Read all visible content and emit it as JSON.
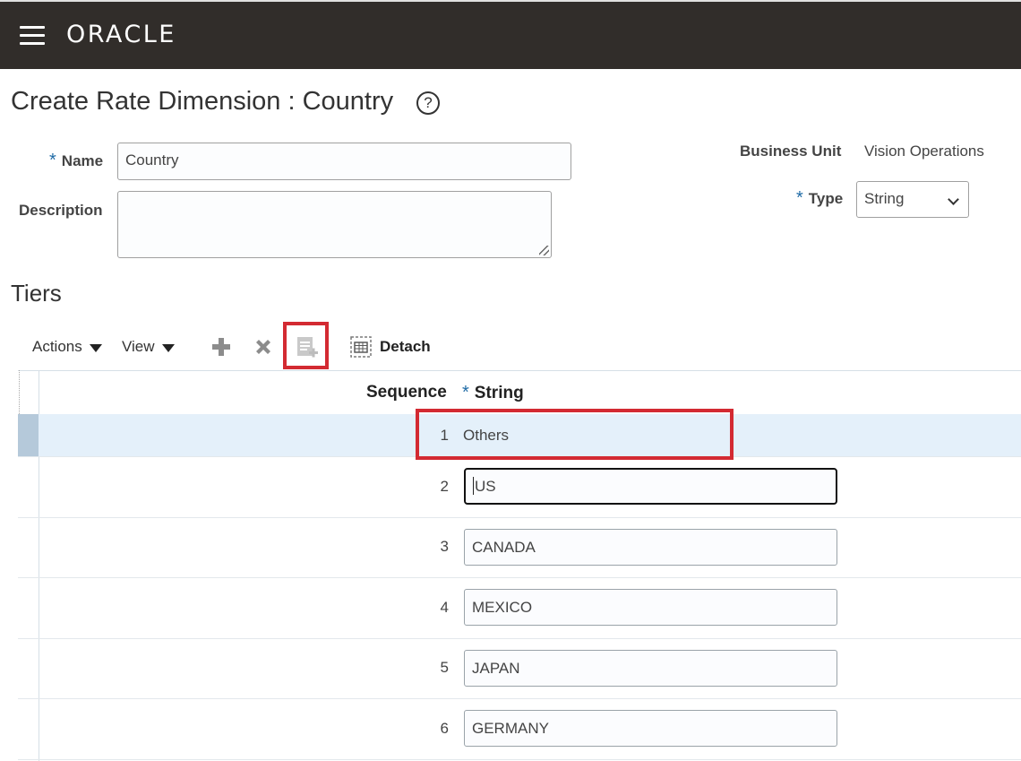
{
  "header": {
    "brand": "ORACLE"
  },
  "page": {
    "title": "Create Rate Dimension : Country",
    "help_glyph": "?"
  },
  "form": {
    "name_label": "Name",
    "name_value": "Country",
    "description_label": "Description",
    "description_value": "",
    "business_unit_label": "Business Unit",
    "business_unit_value": "Vision Operations",
    "type_label": "Type",
    "type_value": "String",
    "required_marker": "*"
  },
  "tiers": {
    "title": "Tiers",
    "toolbar": {
      "actions_label": "Actions",
      "view_label": "View",
      "add_icon": "plus-icon",
      "delete_icon": "x-icon",
      "insert_icon": "insert-row-icon",
      "detach_label": "Detach"
    },
    "columns": {
      "sequence": "Sequence",
      "string": "String"
    },
    "rows": [
      {
        "sequence": "1",
        "string": "Others",
        "editable": false,
        "selected": true
      },
      {
        "sequence": "2",
        "string": "US",
        "editable": true,
        "focused": true
      },
      {
        "sequence": "3",
        "string": "CANADA",
        "editable": true
      },
      {
        "sequence": "4",
        "string": "MEXICO",
        "editable": true
      },
      {
        "sequence": "5",
        "string": "JAPAN",
        "editable": true
      },
      {
        "sequence": "6",
        "string": "GERMANY",
        "editable": true
      }
    ]
  },
  "colors": {
    "header_bg": "#312d2a",
    "highlight": "#d32a32",
    "required": "#1f6ba6",
    "selected_row": "#e4f0fa"
  }
}
